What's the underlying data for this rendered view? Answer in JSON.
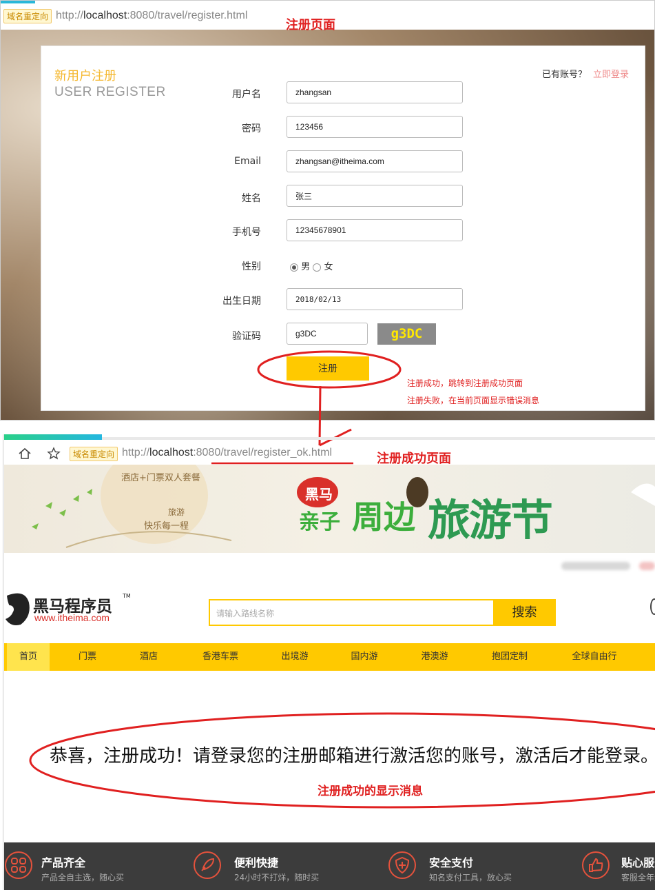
{
  "top": {
    "redirect_tag": "域名重定向",
    "url_prefix": "http://",
    "url_host": "localhost",
    "url_rest": ":8080/travel/register.html",
    "annotation": "注册页面",
    "title_cn": "新用户注册",
    "title_en": "USER REGISTER",
    "login_question": "已有账号？",
    "login_link": "立即登录",
    "fields": {
      "username": {
        "label": "用户名",
        "value": "zhangsan"
      },
      "password": {
        "label": "密码",
        "value": "123456"
      },
      "email": {
        "label": "Email",
        "value": "zhangsan@itheima.com"
      },
      "name": {
        "label": "姓名",
        "value": "张三"
      },
      "phone": {
        "label": "手机号",
        "value": "12345678901"
      },
      "gender": {
        "label": "性别",
        "male": "男",
        "female": "女",
        "selected": "男"
      },
      "birthday": {
        "label": "出生日期",
        "value": "2018/02/13"
      },
      "captcha": {
        "label": "验证码",
        "value": "g3DC",
        "image_text": "g3DC"
      }
    },
    "register_button": "注册",
    "msg_success": "注册成功，跳转到注册成功页面",
    "msg_fail": "注册失败，在当前页面显示错误消息"
  },
  "bottom": {
    "redirect_tag": "域名重定向",
    "url_prefix": "http://",
    "url_host": "localhost",
    "url_rest": ":8080/travel/register_ok.html",
    "annotation": "注册成功页面",
    "banner": {
      "left_line1": "酒店+门票双人套餐",
      "left_line2": "旅游",
      "left_line3": "快乐每一程",
      "tag": "黑马",
      "main_a": "亲子",
      "main_b": "周边",
      "main_c": "旅游节"
    },
    "brand_name": "黑马程序员",
    "brand_tm": "TM",
    "brand_url": "www.itheima.com",
    "search_placeholder": "请输入路线名称",
    "search_button": "搜索",
    "nav": [
      "首页",
      "门票",
      "酒店",
      "香港车票",
      "出境游",
      "国内游",
      "港澳游",
      "抱团定制",
      "全球自由行"
    ],
    "success_message": "恭喜，注册成功！请登录您的注册邮箱进行激活您的账号，激活后才能登录。",
    "success_annotation": "注册成功的显示消息",
    "features": [
      {
        "title": "产品齐全",
        "sub": "产品全自主选，随心买",
        "icon": "grid-icon"
      },
      {
        "title": "便利快捷",
        "sub": "24小时不打烊，随时买",
        "icon": "rocket-icon"
      },
      {
        "title": "安全支付",
        "sub": "知名支付工具，放心买",
        "icon": "shield-icon"
      },
      {
        "title": "贴心服务",
        "sub": "客服全年无休",
        "icon": "thumbs-up-icon"
      }
    ]
  },
  "colors": {
    "accent": "#ffc900",
    "annotation": "#e02020",
    "title": "#f5b830"
  }
}
